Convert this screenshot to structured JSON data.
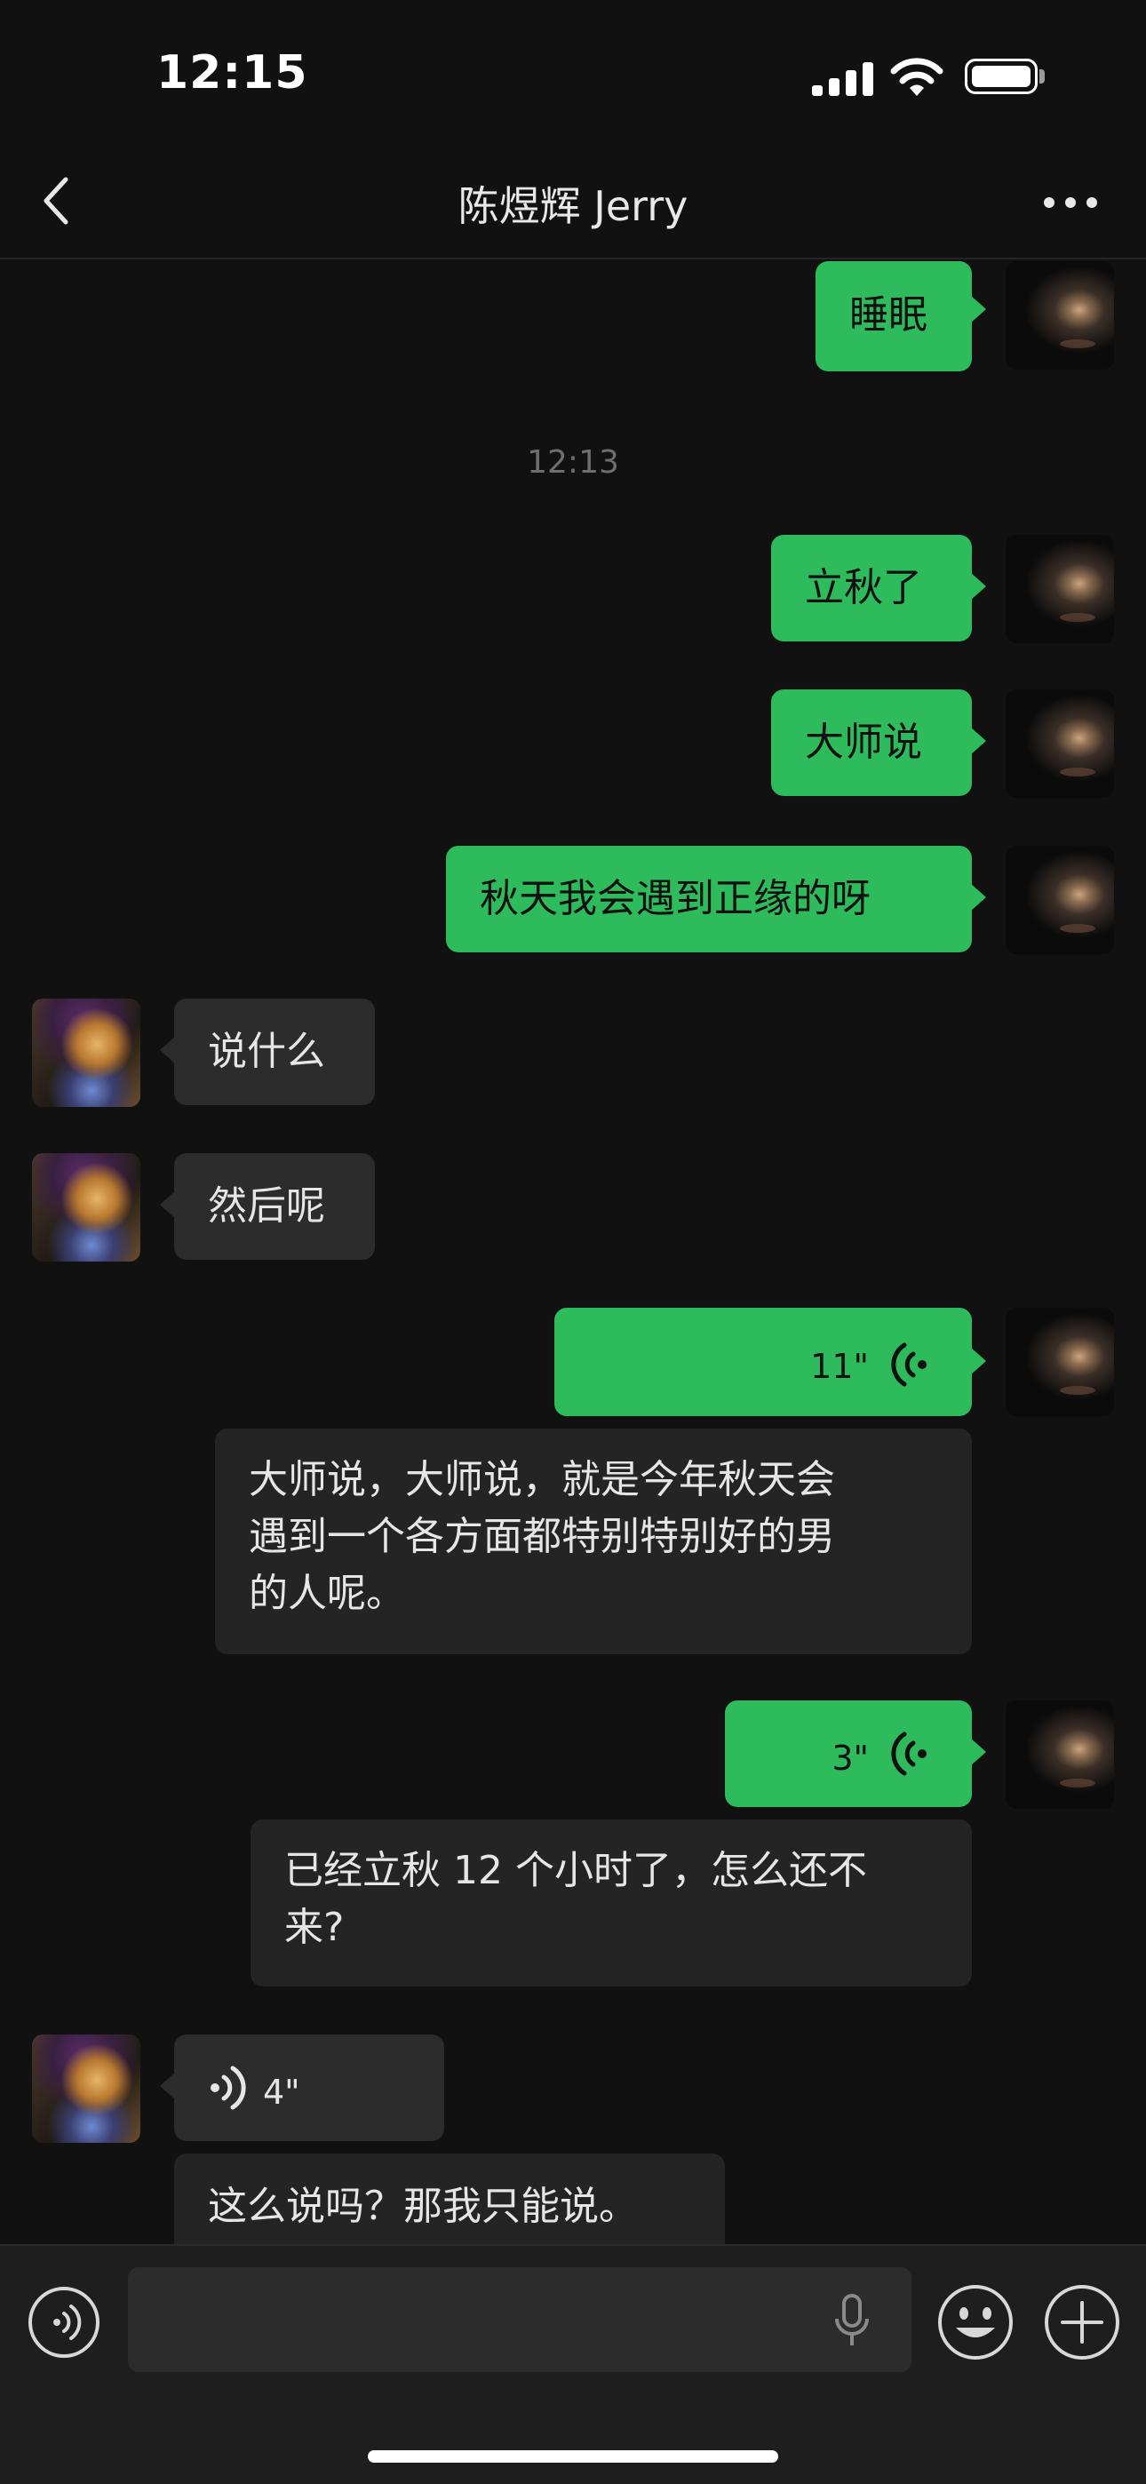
{
  "status_bar": {
    "time": "12:15",
    "icons": [
      "signal-icon",
      "wifi-icon",
      "battery-icon"
    ]
  },
  "nav": {
    "title": "陈煜辉 Jerry",
    "back_icon": "chevron-left-icon",
    "more_icon": "more-icon"
  },
  "timestamp": "12:13",
  "messages": {
    "m0": "睡眠",
    "m1": "立秋了",
    "m2": "大师说",
    "m3": "秋天我会遇到正缘的呀",
    "m4": "说什么",
    "m5": "然后呢",
    "v1": {
      "duration": "11\"",
      "transcript_lines": [
        "大师说，大师说，就是今年秋天会",
        "遇到一个各方面都特别特别好的男",
        "的人呢。"
      ]
    },
    "v2": {
      "duration": "3\"",
      "transcript_lines": [
        "已经立秋 12 个小时了，怎么还不",
        "来?"
      ]
    },
    "v3": {
      "duration": "4\"",
      "transcript": "这么说吗？那我只能说。"
    }
  },
  "bottom_bar": {
    "voice_icon": "voice-mode-icon",
    "mic_icon": "microphone-icon",
    "emoji_icon": "emoji-icon",
    "add_icon": "plus-icon",
    "input_value": ""
  },
  "colors": {
    "background": "#111111",
    "outgoing_bubble": "#2dbb5c",
    "incoming_bubble": "#2c2c2c",
    "bottom_bar": "#1e1e1e"
  }
}
